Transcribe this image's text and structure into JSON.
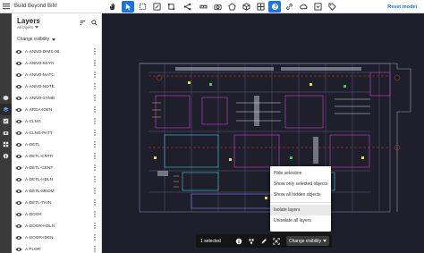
{
  "app": {
    "title": "Build Beyond BIM",
    "menu_icon": "hamburger-icon"
  },
  "toolbar": {
    "tools": [
      {
        "icon": "pan-hand-icon",
        "active": false
      },
      {
        "icon": "select-cursor-icon",
        "active": true
      },
      {
        "icon": "box-select-icon",
        "active": false
      },
      {
        "icon": "edit-markup-icon",
        "active": false
      },
      {
        "icon": "crop-icon",
        "active": false
      },
      {
        "icon": "connector-icon",
        "active": false
      },
      {
        "icon": "measure-ruler-icon",
        "active": false
      },
      {
        "icon": "camera-icon",
        "active": false
      },
      {
        "icon": "shape-outline-icon",
        "active": false
      },
      {
        "icon": "cube-icon",
        "active": false
      },
      {
        "icon": "layout-grid-icon",
        "active": false
      },
      {
        "icon": "help-icon",
        "active": true
      },
      {
        "icon": "link-icon",
        "active": false
      },
      {
        "icon": "cloud-icon",
        "active": false
      },
      {
        "icon": "collapse-icon",
        "active": false
      },
      {
        "icon": "tag-icon",
        "active": false
      }
    ],
    "reset_label": "Reset model"
  },
  "rail": {
    "items": [
      "cube-icon",
      "layers-icon",
      "checklist-icon",
      "camera-icon",
      "grid-icon",
      "info-icon"
    ]
  },
  "panel": {
    "title": "Layers",
    "subtitle": "All layers",
    "change_visibility": "Change visibility",
    "layers": [
      "A-ANNO-DIMS-96",
      "A-ANNO-KEYN",
      "A-ANNO-MATC",
      "A-ANNO-NOTE",
      "A-ANNO-SYMB",
      "A-AREA-IDEN",
      "A-CLNG",
      "A-CLNG-PATT",
      "A-DETL",
      "A-DETL-CNTR",
      "A-DETL-GENF",
      "A-DETL-HDLN",
      "A-DETL-MEDM",
      "A-DETL-THIN",
      "A-DOOR",
      "A-DOOR-HDLN",
      "A-DOOR-IDEN",
      "A-FLOR"
    ]
  },
  "context_menu": {
    "items": [
      "Hide selection",
      "Show only selected objects",
      "Show all hidden objects"
    ],
    "items2": [
      "Isolate layers",
      "Unisolate all layers"
    ]
  },
  "selection_bar": {
    "count_text": "1 selected",
    "button_label": "Change visibility"
  },
  "colors": {
    "accent": "#1a73e8",
    "viewer_bg": "#1e1f2b",
    "rail_bg": "#3a3a3a"
  }
}
